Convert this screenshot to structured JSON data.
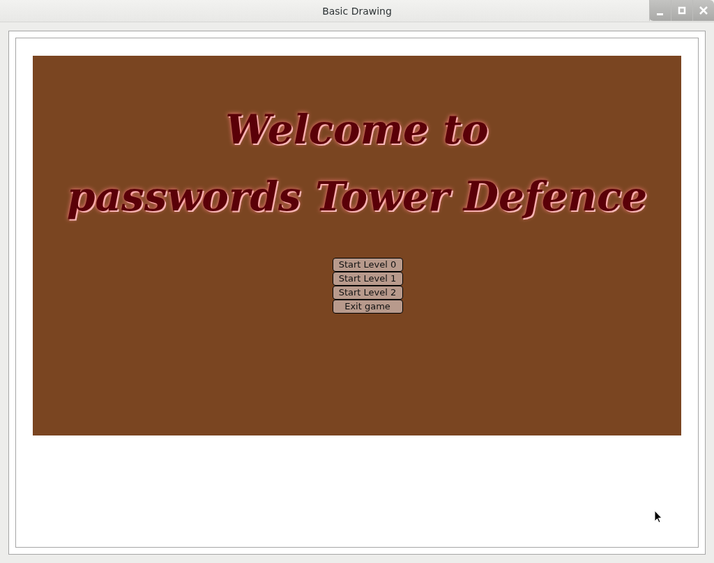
{
  "window": {
    "title": "Basic Drawing"
  },
  "heading": [
    "Welcome to",
    "passwords Tower Defence"
  ],
  "buttons": [
    {
      "label": "Start Level 0"
    },
    {
      "label": "Start Level 1"
    },
    {
      "label": "Start Level 2"
    },
    {
      "label": "Exit game"
    }
  ]
}
